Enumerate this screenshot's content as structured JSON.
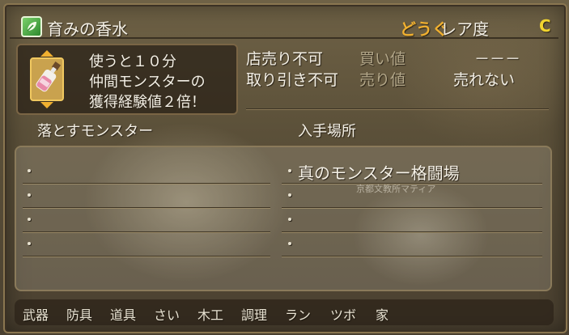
{
  "header": {
    "item_name": "育みの香水",
    "category": "どうぐ",
    "rarity_label": "レア度",
    "rarity_value": "C",
    "icon": "leaf-icon"
  },
  "description": {
    "lines": [
      "使うと１０分",
      "仲間モンスターの",
      "獲得経験値２倍！"
    ],
    "image": "perfume-bottle"
  },
  "trade": {
    "shop_sell": "店売り不可",
    "buy_price_label": "買い値",
    "buy_price_value": "－－－",
    "trade_status": "取り引き不可",
    "sell_price_label": "売り値",
    "sell_price_value": "売れない"
  },
  "sections": {
    "drop_monsters": "落とすモンスター",
    "obtain_locations": "入手場所"
  },
  "locations": [
    "真のモンスター格闘場"
  ],
  "watermark": "京都文教所マティア",
  "tabs": [
    "武器",
    "防具",
    "道具",
    "さい",
    "木工",
    "調理",
    "ラン",
    "ツボ",
    "家"
  ],
  "colors": {
    "category": "#f0b030",
    "rarity": "#f2d52e",
    "panel_border": "#8a7a5a"
  }
}
